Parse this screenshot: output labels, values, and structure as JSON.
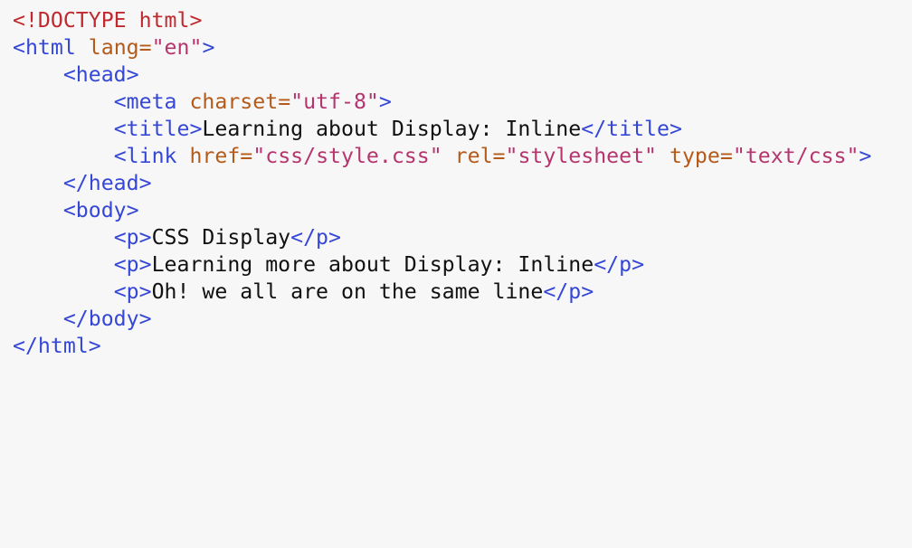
{
  "code": {
    "colors": {
      "background": "#f7f7f7",
      "doctype": "#c0292d",
      "tag": "#3547d6",
      "attribute": "#b45a1a",
      "attribute_value": "#b6356f",
      "text": "#111111"
    },
    "lines": [
      [
        {
          "t": "doctype",
          "s": "<!DOCTYPE html>"
        }
      ],
      [
        {
          "t": "tag",
          "s": "<html"
        },
        {
          "t": "ws",
          "s": " "
        },
        {
          "t": "attr",
          "s": "lang="
        },
        {
          "t": "val",
          "s": "\"en\""
        },
        {
          "t": "tag",
          "s": ">"
        }
      ],
      [
        {
          "t": "ws",
          "s": "    "
        },
        {
          "t": "tag",
          "s": "<head>"
        }
      ],
      [
        {
          "t": "ws",
          "s": "        "
        },
        {
          "t": "tag",
          "s": "<meta"
        },
        {
          "t": "ws",
          "s": " "
        },
        {
          "t": "attr",
          "s": "charset="
        },
        {
          "t": "val",
          "s": "\"utf-8\""
        },
        {
          "t": "tag",
          "s": ">"
        }
      ],
      [
        {
          "t": "ws",
          "s": "        "
        },
        {
          "t": "tag",
          "s": "<title>"
        },
        {
          "t": "text",
          "s": "Learning about Display: Inline"
        },
        {
          "t": "tag",
          "s": "</title>"
        }
      ],
      [
        {
          "t": "ws",
          "s": "        "
        },
        {
          "t": "tag",
          "s": "<link"
        },
        {
          "t": "ws",
          "s": " "
        },
        {
          "t": "attr",
          "s": "href="
        },
        {
          "t": "val",
          "s": "\"css/style.css\""
        },
        {
          "t": "ws",
          "s": " "
        },
        {
          "t": "attr",
          "s": "rel="
        },
        {
          "t": "val",
          "s": "\"stylesheet\""
        },
        {
          "t": "ws",
          "s": " "
        },
        {
          "t": "attr",
          "s": "type="
        },
        {
          "t": "val",
          "s": "\"text/css\""
        },
        {
          "t": "tag",
          "s": ">"
        }
      ],
      [
        {
          "t": "ws",
          "s": "    "
        },
        {
          "t": "tag",
          "s": "</head>"
        }
      ],
      [
        {
          "t": "ws",
          "s": "    "
        },
        {
          "t": "tag",
          "s": "<body>"
        }
      ],
      [
        {
          "t": "ws",
          "s": "        "
        },
        {
          "t": "tag",
          "s": "<p>"
        },
        {
          "t": "text",
          "s": "CSS Display"
        },
        {
          "t": "tag",
          "s": "</p>"
        }
      ],
      [
        {
          "t": "ws",
          "s": "        "
        },
        {
          "t": "tag",
          "s": "<p>"
        },
        {
          "t": "text",
          "s": "Learning more about Display: Inline"
        },
        {
          "t": "tag",
          "s": "</p>"
        }
      ],
      [
        {
          "t": "ws",
          "s": "        "
        },
        {
          "t": "tag",
          "s": "<p>"
        },
        {
          "t": "text",
          "s": "Oh! we all are on the same line"
        },
        {
          "t": "tag",
          "s": "</p>"
        }
      ],
      [
        {
          "t": "ws",
          "s": "    "
        },
        {
          "t": "tag",
          "s": "</body>"
        }
      ],
      [
        {
          "t": "tag",
          "s": "</html>"
        }
      ]
    ]
  }
}
